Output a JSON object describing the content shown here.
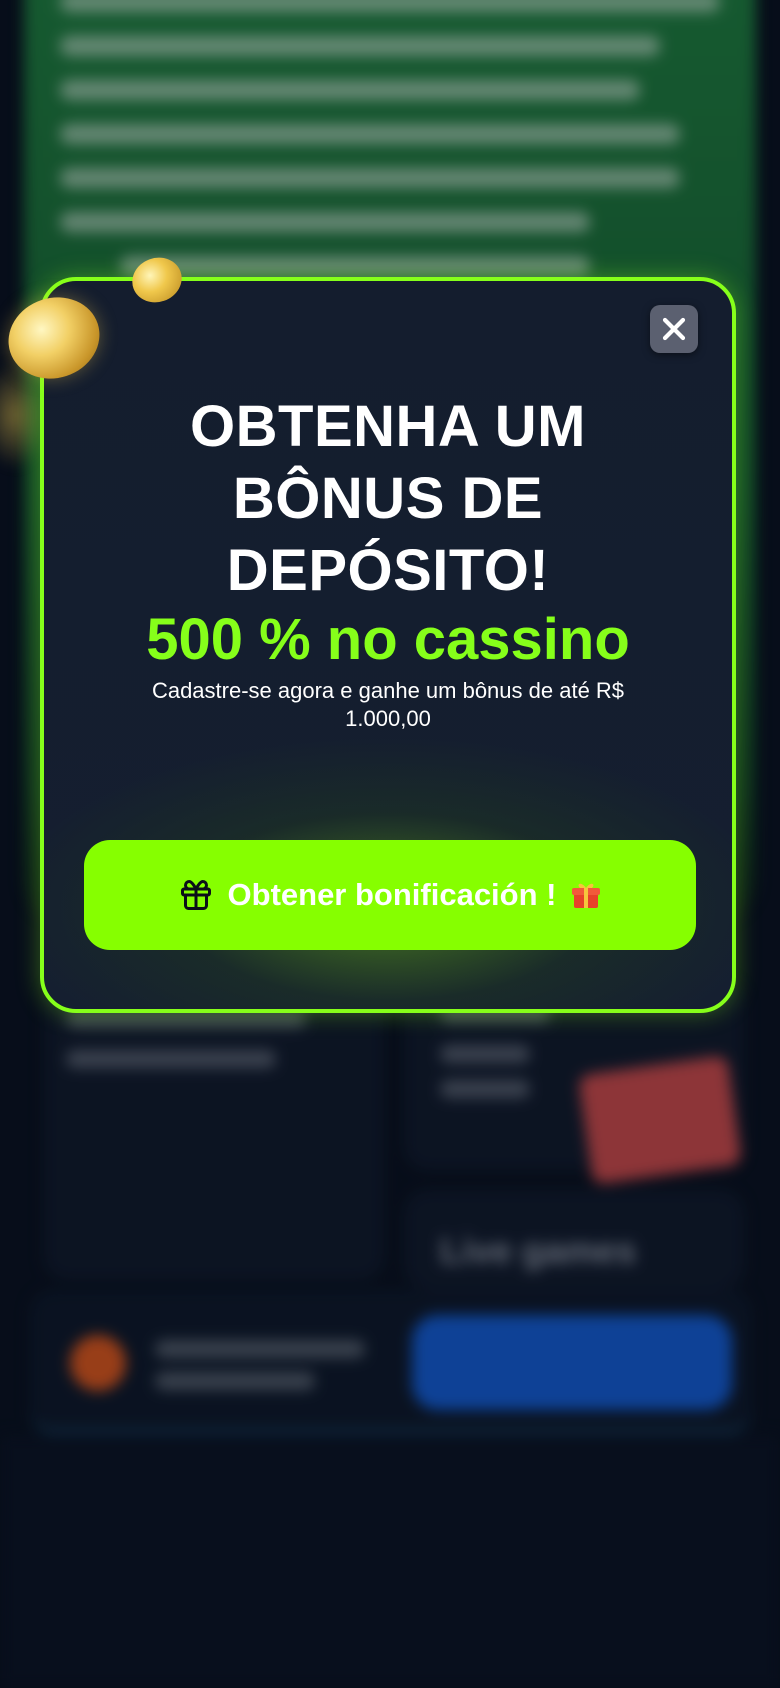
{
  "popup": {
    "title_lines": [
      "OBTENHA UM",
      "BÔNUS DE",
      "DEPÓSITO!"
    ],
    "highlight": "500 % no cassino",
    "description": "Cadastre-se agora e ganhe um bônus de até R$ 1.000,00",
    "cta_label": "Obtener bonificación !",
    "close_icon": "close-icon",
    "cta_icon_left": "gift-icon",
    "cta_icon_right": "gift-emoji-icon"
  },
  "background": {
    "live_games_label": "Live games"
  },
  "colors": {
    "accent_green": "#86ff1a",
    "modal_bg": "#141d2e",
    "page_bg": "#090f1c"
  }
}
